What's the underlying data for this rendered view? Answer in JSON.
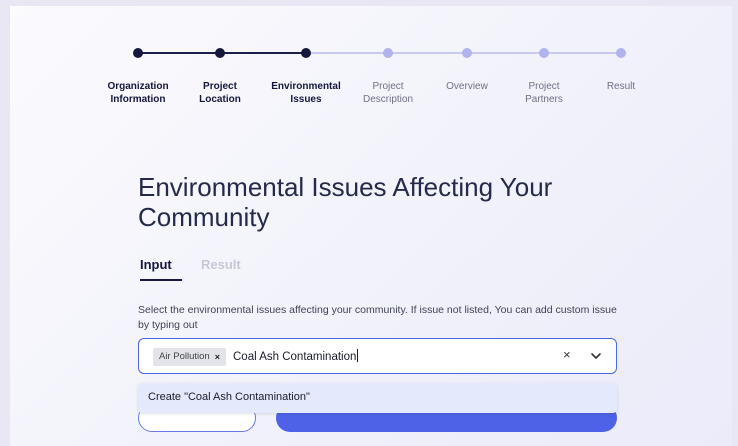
{
  "stepper": {
    "steps": [
      {
        "label": "Organization\nInformation",
        "state": "done"
      },
      {
        "label": "Project\nLocation",
        "state": "done"
      },
      {
        "label": "Environmental\nIssues",
        "state": "done"
      },
      {
        "label": "Project\nDescription",
        "state": "todo"
      },
      {
        "label": "Overview",
        "state": "todo"
      },
      {
        "label": "Project\nPartners",
        "state": "todo"
      },
      {
        "label": "Result",
        "state": "todo"
      }
    ]
  },
  "page": {
    "title": "Environmental Issues Affecting Your Community"
  },
  "tabs": [
    {
      "label": "Input",
      "active": true
    },
    {
      "label": "Result",
      "active": false
    }
  ],
  "form": {
    "help_text": "Select the environmental issues affecting your community. If issue not listed, You can add custom issue by typing out",
    "selected_chips": [
      {
        "label": "Air Pollution"
      }
    ],
    "typed_value": "Coal Ash Contamination",
    "clear_symbol": "×",
    "chip_remove_symbol": "×"
  },
  "dropdown": {
    "options": [
      {
        "label": "Create \"Coal Ash Contamination\""
      }
    ]
  },
  "colors": {
    "accent": "#4e62e8",
    "step_done": "#15173d",
    "step_todo": "#b1b3ee",
    "focus_border": "#4a66e0"
  }
}
